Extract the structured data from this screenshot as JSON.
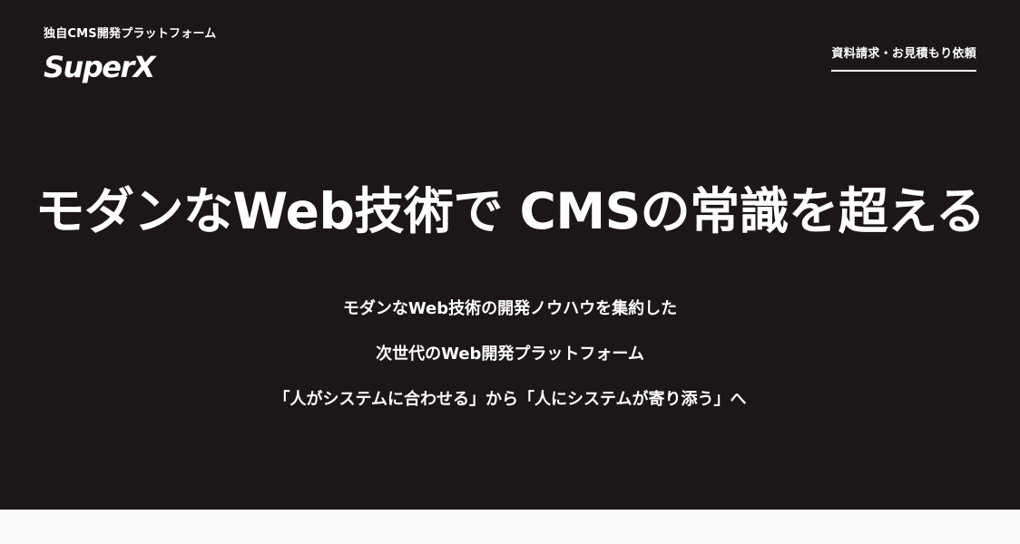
{
  "header": {
    "tagline": "独自CMS開発プラットフォーム",
    "logo_text": "SuperX",
    "cta_label": "資料請求・お見積もり依頼"
  },
  "hero": {
    "headline": "モダンなWeb技術で CMSの常識を超える",
    "sub_lines": [
      "モダンなWeb技術の開発ノウハウを集約した",
      "次世代のWeb開発プラットフォーム",
      "「人がシステムに合わせる」から「人にシステムが寄り添う」へ"
    ]
  },
  "colors": {
    "hero_background": "#1c1617",
    "text": "#ffffff",
    "page_background": "#fafafa"
  }
}
